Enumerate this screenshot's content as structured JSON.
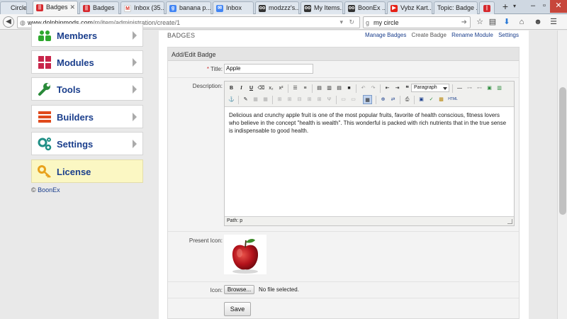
{
  "browser": {
    "tabs": [
      {
        "label": "Circle",
        "icon_color": "#3b5998",
        "active": false
      },
      {
        "label": "Badges",
        "icon_color": "#d6292e",
        "active": true
      },
      {
        "label": "Badges",
        "icon_color": "#d6292e",
        "active": false
      },
      {
        "label": "Inbox (35...",
        "icon_color": "#d93025",
        "icon_glyph": "M",
        "active": false
      },
      {
        "label": "banana p...",
        "icon_color": "#4285f4",
        "icon_glyph": "g",
        "active": false
      },
      {
        "label": "Inbox",
        "icon_color": "#4285f4",
        "active": false
      },
      {
        "label": "modzzz's...",
        "icon_color": "#333333",
        "active": false
      },
      {
        "label": "My Items...",
        "icon_color": "#333333",
        "active": false
      },
      {
        "label": "BoonEx ...",
        "icon_color": "#333333",
        "active": false
      },
      {
        "label": "Vybz Kart...",
        "icon_color": "#e62117",
        "icon_glyph": "▶",
        "active": false
      },
      {
        "label": "Topic: Badge ...",
        "icon_color": "#333333",
        "active": false
      }
    ],
    "url_host": "www.dolphinmods.com",
    "url_path": "/m/item/administration/create/1",
    "search_value": "my circle"
  },
  "sidebar": {
    "items": [
      {
        "label": "Members",
        "icon": "members-icon",
        "color": "#2da82d"
      },
      {
        "label": "Modules",
        "icon": "modules-icon",
        "color": "#c8254a"
      },
      {
        "label": "Tools",
        "icon": "tools-icon",
        "color": "#2a8a3a"
      },
      {
        "label": "Builders",
        "icon": "builders-icon",
        "color": "#e04a1c"
      },
      {
        "label": "Settings",
        "icon": "settings-icon",
        "color": "#1f8f86"
      },
      {
        "label": "License",
        "icon": "key-icon",
        "color": "#e8a21c"
      }
    ],
    "copyright_symbol": "©",
    "copyright_link": "BoonEx"
  },
  "header": {
    "breadcrumb": "BADGES",
    "links": [
      "Manage Badges",
      "Create Badge",
      "Rename Module",
      "Settings"
    ]
  },
  "form": {
    "panel_title": "Add/Edit Badge",
    "title_label": "Title:",
    "title_value": "Apple",
    "description_label": "Description:",
    "description_text": "Delicious and crunchy apple fruit is one of the most popular fruits, favorite of health conscious, fitness lovers who believe in the concept \"health is wealth\". This wonderful is packed with rich nutrients that in the true sense is indispensable to good health.",
    "format_value": "Paragraph",
    "path_label": "Path: p",
    "present_icon_label": "Present Icon:",
    "icon_label": "Icon:",
    "browse_label": "Browse...",
    "no_file_label": "No file selected.",
    "save_label": "Save"
  },
  "toolbar": {
    "bold": "B",
    "italic": "I",
    "underline": "U",
    "subscript": "x₂",
    "superscript": "x²",
    "quote": "❝",
    "html": "HTML"
  },
  "colors": {
    "link_blue": "#1a3e8c",
    "license_bg": "#fbf7c3",
    "close_red": "#c7463b"
  }
}
